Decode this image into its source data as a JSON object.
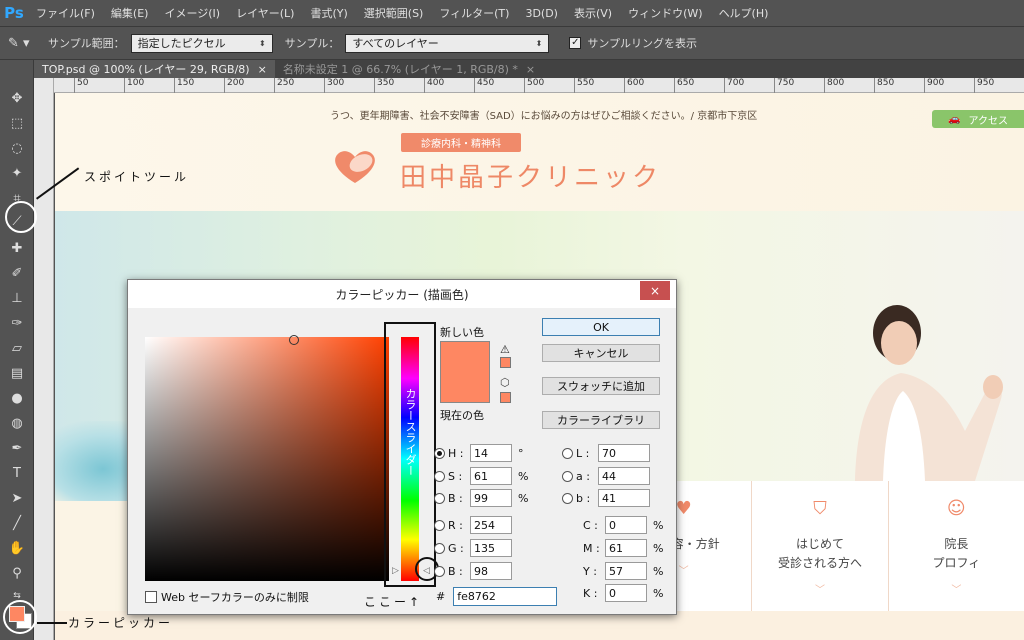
{
  "app": {
    "logo": "Ps"
  },
  "menu": [
    "ファイル(F)",
    "編集(E)",
    "イメージ(I)",
    "レイヤー(L)",
    "書式(Y)",
    "選択範囲(S)",
    "フィルター(T)",
    "3D(D)",
    "表示(V)",
    "ウィンドウ(W)",
    "ヘルプ(H)"
  ],
  "options": {
    "sample_size_label": "サンプル範囲：",
    "sample_size_value": "指定したピクセル",
    "sample_label": "サンプル：",
    "sample_value": "すべてのレイヤー",
    "show_ring_label": "サンプルリングを表示",
    "show_ring_checked": true
  },
  "tabs": [
    {
      "label": "TOP.psd @ 100% (レイヤー 29, RGB/8)",
      "close": "×",
      "active": true
    },
    {
      "label": "名称未設定 1 @ 66.7% (レイヤー 1, RGB/8) *",
      "close": "×",
      "active": false
    }
  ],
  "ruler_h": [
    "50",
    "100",
    "150",
    "200",
    "250",
    "300",
    "350",
    "400",
    "450",
    "500",
    "550",
    "600",
    "650",
    "700",
    "750",
    "800",
    "850",
    "900",
    "950"
  ],
  "website": {
    "notice": "うつ、更年期障害、社会不安障害（SAD）にお悩みの方はぜひご相談ください。/ 京都市下京区",
    "access": "アクセス",
    "badge": "診療内科・精神科",
    "clinic_name": "田中晶子クリニック",
    "nav": [
      {
        "line1": "療内容・方針",
        "line2": "",
        "icon": "plus-heart-icon"
      },
      {
        "line1": "はじめて",
        "line2": "受診される方へ",
        "icon": "leaf-badge-icon"
      },
      {
        "line1": "院長",
        "line2": "プロフィ",
        "icon": "smile-icon"
      }
    ]
  },
  "dialog": {
    "title": "カラーピッカー (描画色)",
    "close": "×",
    "new_label": "新しい色",
    "current_label": "現在の色",
    "new_color": "#fe8762",
    "current_color": "#fe8762",
    "hue_slider_text": "カラースライダー",
    "buttons": {
      "ok": "OK",
      "cancel": "キャンセル",
      "add_swatch": "スウォッチに追加",
      "library": "カラーライブラリ"
    },
    "fields": {
      "H": {
        "value": "14",
        "unit": "°"
      },
      "S": {
        "value": "61",
        "unit": "%"
      },
      "B": {
        "value": "99",
        "unit": "%"
      },
      "R": {
        "value": "254",
        "unit": ""
      },
      "G": {
        "value": "135",
        "unit": ""
      },
      "Bb": {
        "value": "98",
        "unit": ""
      },
      "L": {
        "value": "70",
        "unit": ""
      },
      "a": {
        "value": "44",
        "unit": ""
      },
      "b": {
        "value": "41",
        "unit": ""
      },
      "C": {
        "value": "0",
        "unit": "%"
      },
      "M": {
        "value": "61",
        "unit": "%"
      },
      "Y": {
        "value": "57",
        "unit": "%"
      },
      "K": {
        "value": "0",
        "unit": "%"
      }
    },
    "hex_label": "#",
    "hex": "fe8762",
    "websafe_label": "Web セーフカラーのみに制限",
    "here_annotation": "ここー↑"
  },
  "annotations": {
    "eyedropper": "スポイトツール",
    "color_picker": "カラーピッカー"
  },
  "colors": {
    "foreground": "#fe8762",
    "accent": "#f08a6a",
    "green": "#8ac56a"
  }
}
